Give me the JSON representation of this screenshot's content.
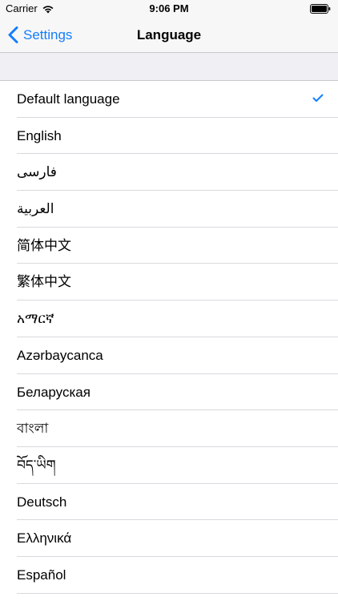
{
  "status_bar": {
    "carrier": "Carrier",
    "time": "9:06 PM"
  },
  "nav": {
    "back_label": "Settings",
    "title": "Language"
  },
  "accent_color": "#147efb",
  "languages": [
    {
      "label": "Default language",
      "selected": true
    },
    {
      "label": "English",
      "selected": false
    },
    {
      "label": "فارسی",
      "selected": false
    },
    {
      "label": "العربية",
      "selected": false
    },
    {
      "label": "简体中文",
      "selected": false
    },
    {
      "label": "繁体中文",
      "selected": false
    },
    {
      "label": "አማርኛ",
      "selected": false
    },
    {
      "label": "Azərbaycanca",
      "selected": false
    },
    {
      "label": "Беларуская",
      "selected": false
    },
    {
      "label": "বাংলা",
      "selected": false
    },
    {
      "label": "བོད་ཡིག",
      "selected": false
    },
    {
      "label": "Deutsch",
      "selected": false
    },
    {
      "label": "Ελληνικά",
      "selected": false
    },
    {
      "label": "Español",
      "selected": false
    }
  ]
}
